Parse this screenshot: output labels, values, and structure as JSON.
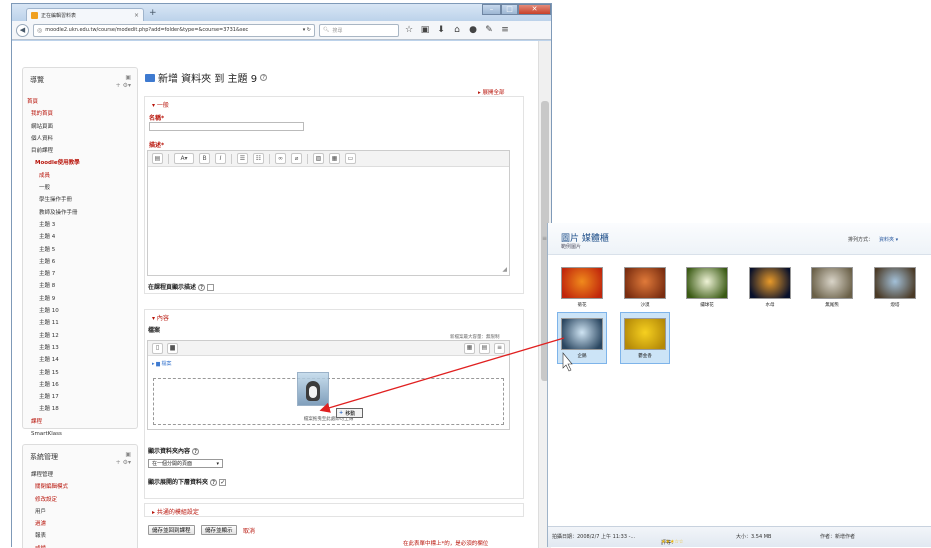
{
  "browser": {
    "tab_title": "正在編輯習料表",
    "tab_close": "×",
    "new_tab": "+",
    "url": "moodle2.ukn.edu.tw/course/modedit.php?add=folder&type=&course=3731&sec",
    "search_placeholder": "搜尋",
    "window_buttons": {
      "min": "–",
      "max": "□",
      "close": "✕"
    },
    "toolbar_icons": [
      "star-icon",
      "clipboard-icon",
      "download-icon",
      "home-icon",
      "sync-icon",
      "menu-icon"
    ]
  },
  "nav_block": {
    "title": "導覽",
    "items": [
      {
        "label": "首頁",
        "style": "red"
      },
      {
        "label": "我的首頁",
        "style": "red"
      },
      {
        "label": "網站頁面",
        "style": "normal"
      },
      {
        "label": "個人資料",
        "style": "normal"
      },
      {
        "label": "目前課程",
        "style": "normal"
      },
      {
        "label": "Moodle使用教學",
        "style": "red bold"
      },
      {
        "label": "成員",
        "style": "red"
      },
      {
        "label": "一般",
        "style": "normal"
      },
      {
        "label": "學生操作手冊",
        "style": "normal"
      },
      {
        "label": "教師及操作手冊",
        "style": "normal"
      },
      {
        "label": "主題 3",
        "style": "normal"
      },
      {
        "label": "主題 4",
        "style": "normal"
      },
      {
        "label": "主題 5",
        "style": "normal"
      },
      {
        "label": "主題 6",
        "style": "normal"
      },
      {
        "label": "主題 7",
        "style": "normal"
      },
      {
        "label": "主題 8",
        "style": "normal"
      },
      {
        "label": "主題 9",
        "style": "normal"
      },
      {
        "label": "主題 10",
        "style": "normal"
      },
      {
        "label": "主題 11",
        "style": "normal"
      },
      {
        "label": "主題 12",
        "style": "normal"
      },
      {
        "label": "主題 13",
        "style": "normal"
      },
      {
        "label": "主題 14",
        "style": "normal"
      },
      {
        "label": "主題 15",
        "style": "normal"
      },
      {
        "label": "主題 16",
        "style": "normal"
      },
      {
        "label": "主題 17",
        "style": "normal"
      },
      {
        "label": "主題 18",
        "style": "normal"
      },
      {
        "label": "課程",
        "style": "red"
      },
      {
        "label": "SmartKlass",
        "style": "normal"
      }
    ]
  },
  "admin_block": {
    "title": "系統管理",
    "items": [
      {
        "label": "課程管理",
        "style": "normal"
      },
      {
        "label": "關閉編輯模式",
        "style": "red"
      },
      {
        "label": "修改設定",
        "style": "red"
      },
      {
        "label": "用戶",
        "style": "normal"
      },
      {
        "label": "過濾",
        "style": "red"
      },
      {
        "label": "報表",
        "style": "normal"
      },
      {
        "label": "成績",
        "style": "red"
      },
      {
        "label": "備份",
        "style": "red"
      }
    ]
  },
  "main": {
    "title": "新增 資料夾 到 主題 9",
    "expand_all": "展開全部",
    "general": {
      "legend": "一般",
      "name_label": "名稱",
      "description_label": "描述",
      "show_desc_label": "在課程頁顯示描述"
    },
    "content": {
      "legend": "內容",
      "files_label": "檔案",
      "max_size": "新檔案最大容量：無限制",
      "path": "檔案",
      "drop_hint": "檔案拖曳至此處即可上傳",
      "display_label": "顯示資料夾內容",
      "display_value": "在一個分開的頁面",
      "show_subfolders_label": "顯示展開的下層資料夾"
    },
    "common_settings": "共通的模組設定",
    "drag_tip": "移動",
    "buttons": {
      "save_return": "儲存並回到課程",
      "save_display": "儲存並顯示",
      "cancel": "取消"
    },
    "required_note": "在此表單中標上*的，是必須的欄位"
  },
  "photos": {
    "title": "圖片 媒體櫃",
    "subtitle": "範例圖片",
    "sort_label": "排列方式：",
    "sort_value": "資料夾 ▾",
    "items": [
      {
        "label": "菊花",
        "colors": [
          "#f08a1c",
          "#c0260c"
        ],
        "selected": false
      },
      {
        "label": "沙漠",
        "colors": [
          "#e07a3a",
          "#7a2d10"
        ],
        "selected": false
      },
      {
        "label": "繡球花",
        "colors": [
          "#eef2d6",
          "#3a5a14"
        ],
        "selected": false
      },
      {
        "label": "水母",
        "colors": [
          "#e89a2a",
          "#08102a"
        ],
        "selected": false
      },
      {
        "label": "無尾熊",
        "colors": [
          "#d9d4c8",
          "#6a6048"
        ],
        "selected": false
      },
      {
        "label": "燈塔",
        "colors": [
          "#a3c0d8",
          "#4a3a26"
        ],
        "selected": false
      },
      {
        "label": "企鵝",
        "colors": [
          "#cfe4f3",
          "#2a4660"
        ],
        "selected": true
      },
      {
        "label": "鬱金香",
        "colors": [
          "#f6d020",
          "#b58a08"
        ],
        "selected": true
      }
    ],
    "status": {
      "date": "拍攝日期：2008/2/7 上午 11:33 -...",
      "rating_label": "評等：",
      "rating": 3,
      "size": "大小：3.54 MB",
      "author": "作者：新增作者"
    }
  },
  "colors": {
    "moodle_red": "#b8140a",
    "link_blue": "#3e7ad0",
    "annotation_arrow": "#e02020",
    "selection": "#cce4f7"
  }
}
